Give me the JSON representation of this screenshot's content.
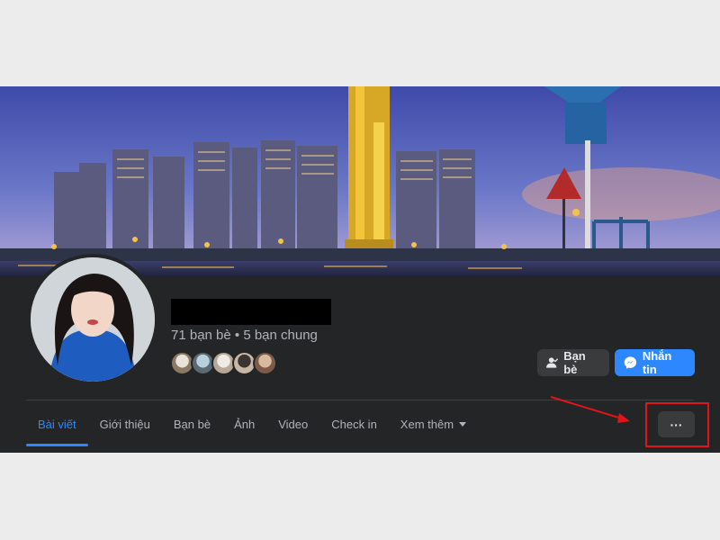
{
  "profile": {
    "friend_summary": "71 bạn bè • 5 bạn chung",
    "mutual_friend_avatars": [
      "mutual-friend-1",
      "mutual-friend-2",
      "mutual-friend-3",
      "mutual-friend-4",
      "mutual-friend-5"
    ]
  },
  "actions": {
    "friends_label": "Bạn bè",
    "message_label": "Nhắn tin"
  },
  "tabs": [
    {
      "label": "Bài viết",
      "active": true
    },
    {
      "label": "Giới thiệu"
    },
    {
      "label": "Bạn bè"
    },
    {
      "label": "Ảnh"
    },
    {
      "label": "Video"
    },
    {
      "label": "Check in"
    },
    {
      "label": "Xem thêm"
    }
  ],
  "more_button": {
    "label": "···"
  },
  "icons": {
    "friends": "person-check-icon",
    "message": "messenger-icon",
    "dropdown": "caret-down-icon"
  },
  "colors": {
    "panel_bg": "#242526",
    "accent": "#2d88ff",
    "secondary_btn": "#3a3b3c",
    "annotation": "#e0141a"
  }
}
